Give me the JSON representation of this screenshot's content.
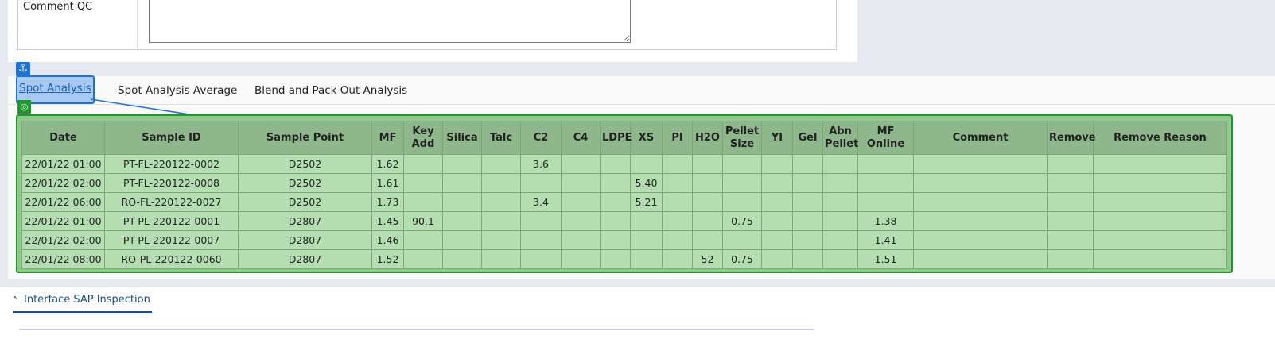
{
  "comment_qc": {
    "label": "Comment QC",
    "value": ""
  },
  "tabs": [
    {
      "label": "Spot Analysis",
      "active": true
    },
    {
      "label": "Spot Analysis Average",
      "active": false
    },
    {
      "label": "Blend and Pack Out Analysis",
      "active": false
    }
  ],
  "icons": {
    "anchor": "anchor-icon",
    "target": "target-icon",
    "collapse": "chevron-up-icon"
  },
  "colors": {
    "selection_blue": "#1a73d9",
    "grid_green": "#1e9a2a",
    "header_green": "#8fb78c",
    "cell_green": "#b4deb1"
  },
  "table": {
    "columns": [
      "Date",
      "Sample ID",
      "Sample Point",
      "MF",
      "Key Add",
      "Silica",
      "Talc",
      "C2",
      "C4",
      "LDPE",
      "XS",
      "PI",
      "H2O",
      "Pellet Size",
      "YI",
      "Gel",
      "Abn Pellet",
      "MF Online",
      "Comment",
      "Remove",
      "Remove Reason"
    ],
    "rows": [
      [
        "22/01/22 01:00",
        "PT-FL-220122-0002",
        "D2502",
        "1.62",
        "",
        "",
        "",
        "3.6",
        "",
        "",
        "",
        "",
        "",
        "",
        "",
        "",
        "",
        "",
        "",
        "",
        ""
      ],
      [
        "22/01/22 02:00",
        "PT-FL-220122-0008",
        "D2502",
        "1.61",
        "",
        "",
        "",
        "",
        "",
        "",
        "5.40",
        "",
        "",
        "",
        "",
        "",
        "",
        "",
        "",
        "",
        ""
      ],
      [
        "22/01/22 06:00",
        "RO-FL-220122-0027",
        "D2502",
        "1.73",
        "",
        "",
        "",
        "3.4",
        "",
        "",
        "5.21",
        "",
        "",
        "",
        "",
        "",
        "",
        "",
        "",
        "",
        ""
      ],
      [
        "22/01/22 01:00",
        "PT-PL-220122-0001",
        "D2807",
        "1.45",
        "90.1",
        "",
        "",
        "",
        "",
        "",
        "",
        "",
        "",
        "0.75",
        "",
        "",
        "",
        "1.38",
        "",
        "",
        ""
      ],
      [
        "22/01/22 02:00",
        "PT-PL-220122-0007",
        "D2807",
        "1.46",
        "",
        "",
        "",
        "",
        "",
        "",
        "",
        "",
        "",
        "",
        "",
        "",
        "",
        "1.41",
        "",
        "",
        ""
      ],
      [
        "22/01/22 08:00",
        "RO-PL-220122-0060",
        "D2807",
        "1.52",
        "",
        "",
        "",
        "",
        "",
        "",
        "",
        "",
        "52",
        "0.75",
        "",
        "",
        "",
        "1.51",
        "",
        "",
        ""
      ]
    ]
  },
  "section": {
    "label": "Interface SAP Inspection"
  }
}
